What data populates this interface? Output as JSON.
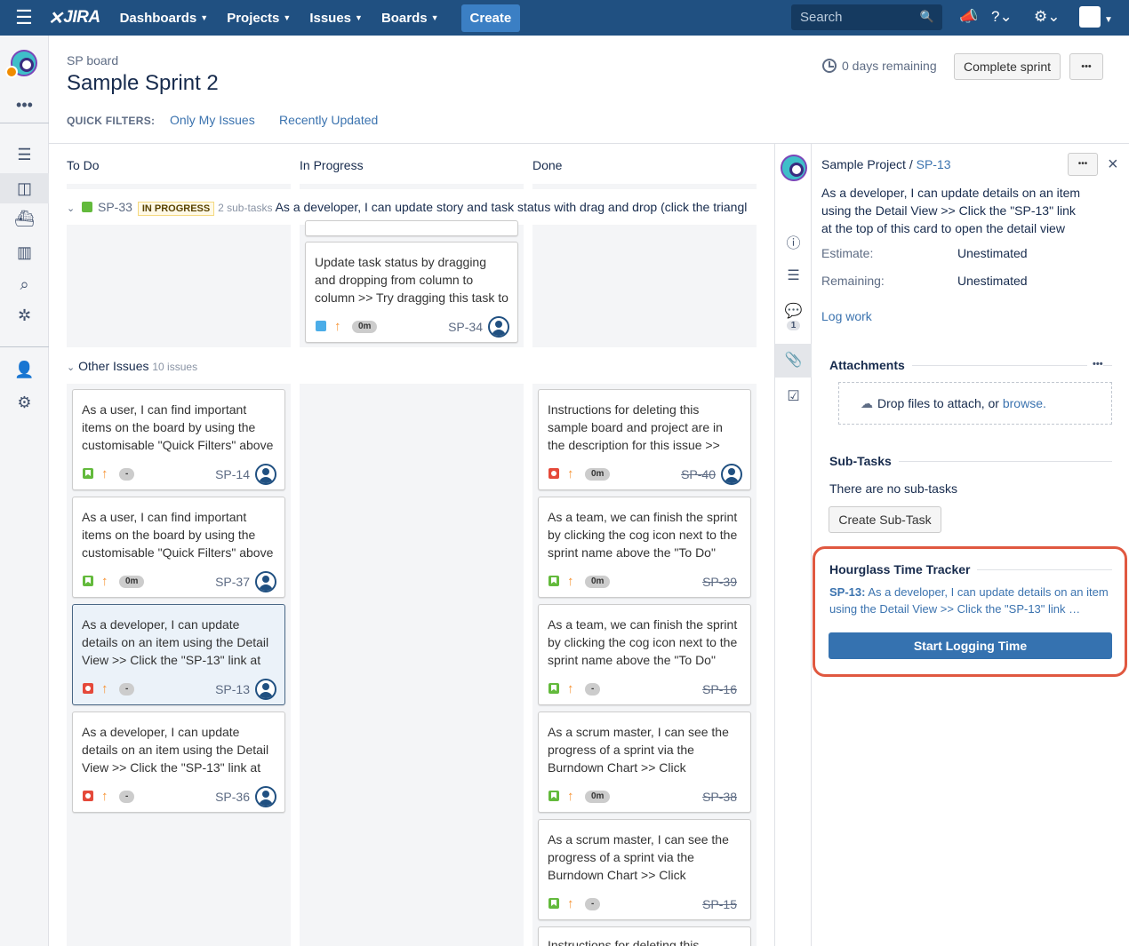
{
  "nav": {
    "logo": "JIRA",
    "dashboards": "Dashboards",
    "projects": "Projects",
    "issues": "Issues",
    "boards": "Boards",
    "create": "Create",
    "search_placeholder": "Search"
  },
  "header": {
    "board": "SP board",
    "sprint": "Sample Sprint 2",
    "quick_filters_label": "QUICK FILTERS:",
    "filter_mine": "Only My Issues",
    "filter_recent": "Recently Updated",
    "days_remaining": "0 days remaining",
    "complete_sprint": "Complete sprint",
    "more": "•••"
  },
  "columns": {
    "todo": "To Do",
    "inprogress": "In Progress",
    "done": "Done"
  },
  "swimlane1": {
    "key": "SP-33",
    "status": "IN PROGRESS",
    "subtasks": "2 sub-tasks",
    "summary": "As a developer, I can update story and task status with drag and drop (click the triangle"
  },
  "swimlane2": {
    "title": "Other Issues",
    "count": "10 issues"
  },
  "cards": {
    "sp34": {
      "summary": "Update task status by dragging and dropping from column to column >> Try dragging this task to",
      "estimate": "0m",
      "key": "SP-34"
    },
    "sp14": {
      "summary": "As a user, I can find important items on the board by using the customisable \"Quick Filters\" above",
      "estimate": "-",
      "key": "SP-14"
    },
    "sp37": {
      "summary": "As a user, I can find important items on the board by using the customisable \"Quick Filters\" above",
      "estimate": "0m",
      "key": "SP-37"
    },
    "sp13": {
      "summary": "As a developer, I can update details on an item using the Detail View >> Click the \"SP-13\" link at",
      "estimate": "-",
      "key": "SP-13"
    },
    "sp36": {
      "summary": "As a developer, I can update details on an item using the Detail View >> Click the \"SP-13\" link at",
      "estimate": "-",
      "key": "SP-36"
    },
    "sp40": {
      "summary": "Instructions for deleting this sample board and project are in the description for this issue >> Click",
      "estimate": "0m",
      "key": "SP-40"
    },
    "sp39": {
      "summary": "As a team, we can finish the sprint by clicking the cog icon next to the sprint name above the \"To Do\"",
      "estimate": "0m",
      "key": "SP-39"
    },
    "sp16": {
      "summary": "As a team, we can finish the sprint by clicking the cog icon next to the sprint name above the \"To Do\"",
      "estimate": "-",
      "key": "SP-16"
    },
    "sp38": {
      "summary": "As a scrum master, I can see the progress of a sprint via the Burndown Chart >> Click \"Reports\"",
      "estimate": "0m",
      "key": "SP-38"
    },
    "sp15": {
      "summary": "As a scrum master, I can see the progress of a sprint via the Burndown Chart >> Click \"Reports\"",
      "estimate": "-",
      "key": "SP-15"
    },
    "sp_last": {
      "summary": "Instructions for deleting this sample"
    }
  },
  "detail": {
    "project": "Sample Project /",
    "key": "SP-13",
    "summary": "As a developer, I can update details on an item using the Detail View >> Click the \"SP-13\" link at the top of this card to open the detail view",
    "estimate_label": "Estimate:",
    "estimate_value": "Unestimated",
    "remaining_label": "Remaining:",
    "remaining_value": "Unestimated",
    "log_work": "Log work",
    "comment_count": "1",
    "attachments": "Attachments",
    "drop_text": "Drop files to attach, or",
    "browse": "browse.",
    "subtasks": "Sub-Tasks",
    "no_subtasks": "There are no sub-tasks",
    "create_subtask": "Create Sub-Task",
    "tracker_title": "Hourglass Time Tracker",
    "tracker_key": "SP-13:",
    "tracker_summary": "As a developer, I can update details on an item using the Detail View >> Click the \"SP-13\" link …",
    "start_logging": "Start Logging Time"
  },
  "colors": {
    "nav": "#205081",
    "link": "#3b73af",
    "highlight": "#e05840",
    "story": "#63ba3c",
    "bug": "#e5493a"
  }
}
